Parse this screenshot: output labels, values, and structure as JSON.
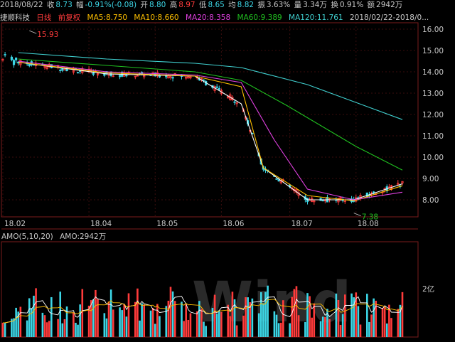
{
  "header": {
    "date": "2018/08/22",
    "close_label": "收",
    "close": "8.73",
    "chg_label": "幅",
    "chg": "-0.91%(-0.08)",
    "open_label": "开",
    "open": "8.80",
    "high_label": "高",
    "high": "8.97",
    "low_label": "低",
    "low": "8.65",
    "avg_label": "均",
    "avg": "8.82",
    "amp_label": "振",
    "amp": "3.63%",
    "vol_label": "量",
    "vol": "3.34万",
    "turn_label": "换",
    "turn": "0.91%",
    "amt_label": "额",
    "amt": "2942万"
  },
  "legend": {
    "stock_name": "捷顺科技",
    "period": "日线",
    "adjust": "前复权",
    "ma5": "MA5:8.750",
    "ma10": "MA10:8.660",
    "ma20": "MA20:8.358",
    "ma60": "MA60:9.389",
    "ma120": "MA120:11.761",
    "range": "2018/02/22-2018/0..."
  },
  "price_axis": [
    "16.00",
    "15.00",
    "14.00",
    "13.00",
    "12.00",
    "11.00",
    "10.00",
    "9.00",
    "8.00"
  ],
  "date_axis": [
    "18.02",
    "18.04",
    "18.05",
    "18.06",
    "18.07",
    "18.08"
  ],
  "annotations": {
    "high_mark": "15.93",
    "low_mark": "7.38"
  },
  "volume": {
    "label": "AMO(5,10,20)",
    "value": "AMO:2942万",
    "axis_label": "2亿"
  },
  "watermark": "Wind",
  "colors": {
    "up": "#ff3b3b",
    "down": "#3cd6e6",
    "ma5": "#ffffff",
    "ma10": "#ffc000",
    "ma20": "#e040e0",
    "ma60": "#20c020",
    "ma120": "#40d0d0"
  },
  "chart_data": {
    "type": "line",
    "series": [
      {
        "name": "MA5",
        "x": [
          "2018/03/01",
          "2018/04/10",
          "2018/05/20",
          "2018/06/10",
          "2018/06/20",
          "2018/07/10",
          "2018/07/31",
          "2018/08/22"
        ],
        "values": [
          14.45,
          13.9,
          13.8,
          12.5,
          9.5,
          8.0,
          8.0,
          8.75
        ]
      },
      {
        "name": "MA10",
        "x": [
          "2018/03/01",
          "2018/04/10",
          "2018/05/20",
          "2018/06/10",
          "2018/06/20",
          "2018/07/10",
          "2018/07/31",
          "2018/08/22"
        ],
        "values": [
          14.45,
          13.95,
          13.8,
          13.3,
          9.5,
          8.2,
          7.95,
          8.66
        ]
      },
      {
        "name": "MA20",
        "x": [
          "2018/03/01",
          "2018/04/10",
          "2018/05/20",
          "2018/06/10",
          "2018/06/25",
          "2018/07/10",
          "2018/07/31",
          "2018/08/22"
        ],
        "values": [
          14.5,
          14.0,
          13.85,
          13.5,
          10.8,
          8.5,
          8.0,
          8.358
        ]
      },
      {
        "name": "MA60",
        "x": [
          "2018/03/01",
          "2018/04/10",
          "2018/05/20",
          "2018/06/10",
          "2018/07/01",
          "2018/08/01",
          "2018/08/22"
        ],
        "values": [
          14.6,
          14.3,
          14.0,
          13.6,
          12.4,
          10.5,
          9.389
        ]
      },
      {
        "name": "MA120",
        "x": [
          "2018/03/01",
          "2018/04/10",
          "2018/05/20",
          "2018/06/10",
          "2018/07/10",
          "2018/08/22"
        ],
        "values": [
          14.9,
          14.6,
          14.4,
          14.2,
          13.4,
          11.761
        ]
      }
    ],
    "ylim": [
      7.2,
      16.3
    ],
    "high": 15.93,
    "low": 7.38,
    "grid": true
  }
}
